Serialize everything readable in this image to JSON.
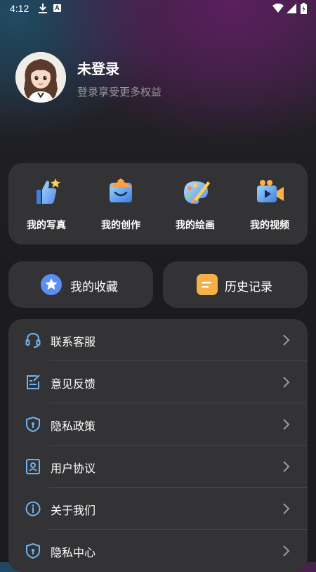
{
  "status_bar": {
    "time": "4:12",
    "app_badge": "A"
  },
  "profile": {
    "name": "未登录",
    "subtitle": "登录享受更多权益"
  },
  "quick_actions": [
    {
      "label": "我的写真",
      "icon": "thumbs-up-star-icon"
    },
    {
      "label": "我的创作",
      "icon": "smile-envelope-icon"
    },
    {
      "label": "我的绘画",
      "icon": "palette-brush-icon"
    },
    {
      "label": "我的视频",
      "icon": "video-camera-icon"
    }
  ],
  "cards": [
    {
      "label": "我的收藏",
      "icon": "star-icon"
    },
    {
      "label": "历史记录",
      "icon": "document-icon"
    }
  ],
  "menu": [
    {
      "label": "联系客服",
      "icon": "headset-icon"
    },
    {
      "label": "意见反馈",
      "icon": "feedback-edit-icon"
    },
    {
      "label": "隐私政策",
      "icon": "shield-lock-icon"
    },
    {
      "label": "用户协议",
      "icon": "user-agreement-icon"
    },
    {
      "label": "关于我们",
      "icon": "info-icon"
    },
    {
      "label": "隐私中心",
      "icon": "shield-lock-icon"
    }
  ],
  "colors": {
    "background": "#1c1c1e",
    "panel": "#333336",
    "icon_blue": "#6fb3f0",
    "star_badge": "#5b8df5",
    "document_badge": "#f5b04a",
    "subtitle_text": "#9a96a0"
  }
}
